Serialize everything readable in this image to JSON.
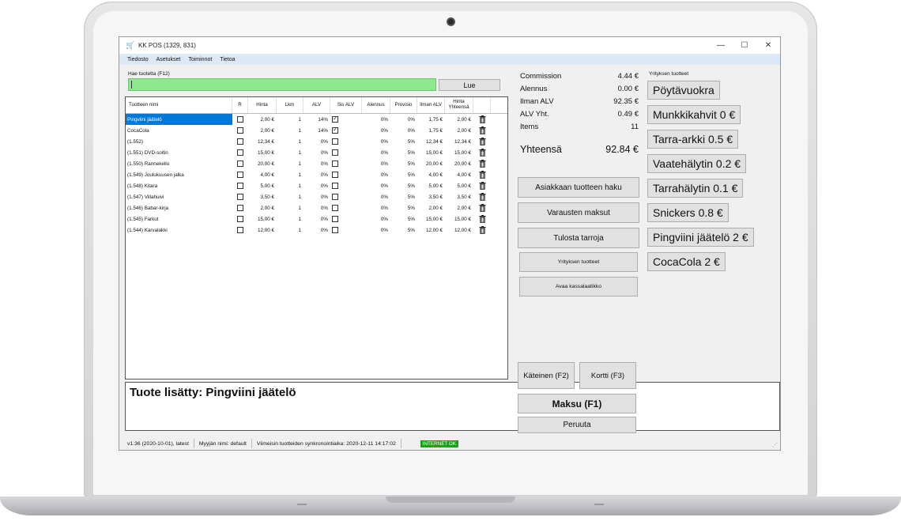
{
  "window": {
    "title": "KK POS (1329, 831)",
    "app_icon": "🛒",
    "minimize": "—",
    "maximize": "☐",
    "close": "✕"
  },
  "menu": [
    "Tiedosto",
    "Asetukset",
    "Toiminnot",
    "Tietoa"
  ],
  "search": {
    "label": "Hae tuotetta (F12)",
    "value": "",
    "button": "Lue"
  },
  "table": {
    "headers": {
      "name": "Tuotteen nimi",
      "r": "R",
      "hinta": "Hinta",
      "lkm": "Lkm",
      "alv": "ALV",
      "sis_alv": "Sis ALV",
      "alennus": "Alennus",
      "provisio": "Provisio",
      "ilman_alv": "Ilman ALV",
      "hinta_yhteensa": "Hinta Yhteensä"
    },
    "rows": [
      {
        "name": "Pingviini jäätelö",
        "r": false,
        "hinta": "2,00 €",
        "lkm": "1",
        "alv": "14%",
        "sis_alv": true,
        "alennus": "0%",
        "provisio": "0%",
        "ilman_alv": "1,75 €",
        "yhteensa": "2,00 €",
        "selected": true
      },
      {
        "name": "CocaCola",
        "r": false,
        "hinta": "2,00 €",
        "lkm": "1",
        "alv": "14%",
        "sis_alv": true,
        "alennus": "0%",
        "provisio": "0%",
        "ilman_alv": "1,75 €",
        "yhteensa": "2,00 €",
        "selected": false
      },
      {
        "name": "(1.552)",
        "r": false,
        "hinta": "12,34 €",
        "lkm": "1",
        "alv": "0%",
        "sis_alv": false,
        "alennus": "0%",
        "provisio": "5%",
        "ilman_alv": "12,34 €",
        "yhteensa": "12,34 €",
        "selected": false
      },
      {
        "name": "(1.551) DVD-soitin",
        "r": false,
        "hinta": "15,00 €",
        "lkm": "1",
        "alv": "0%",
        "sis_alv": false,
        "alennus": "0%",
        "provisio": "5%",
        "ilman_alv": "15,00 €",
        "yhteensa": "15,00 €",
        "selected": false
      },
      {
        "name": "(1.550) Rannekello",
        "r": false,
        "hinta": "20,00 €",
        "lkm": "1",
        "alv": "0%",
        "sis_alv": false,
        "alennus": "0%",
        "provisio": "5%",
        "ilman_alv": "20,00 €",
        "yhteensa": "20,00 €",
        "selected": false
      },
      {
        "name": "(1.549) Joulukuusen jalka",
        "r": false,
        "hinta": "4,00 €",
        "lkm": "1",
        "alv": "0%",
        "sis_alv": false,
        "alennus": "0%",
        "provisio": "5%",
        "ilman_alv": "4,00 €",
        "yhteensa": "4,00 €",
        "selected": false
      },
      {
        "name": "(1.548) Kitara",
        "r": false,
        "hinta": "5,00 €",
        "lkm": "1",
        "alv": "0%",
        "sis_alv": false,
        "alennus": "0%",
        "provisio": "5%",
        "ilman_alv": "5,00 €",
        "yhteensa": "5,00 €",
        "selected": false
      },
      {
        "name": "(1.547) Villahuivi",
        "r": false,
        "hinta": "3,50 €",
        "lkm": "1",
        "alv": "0%",
        "sis_alv": false,
        "alennus": "0%",
        "provisio": "5%",
        "ilman_alv": "3,50 €",
        "yhteensa": "3,50 €",
        "selected": false
      },
      {
        "name": "(1.546) Babar-kirja",
        "r": false,
        "hinta": "2,00 €",
        "lkm": "1",
        "alv": "0%",
        "sis_alv": false,
        "alennus": "0%",
        "provisio": "5%",
        "ilman_alv": "2,00 €",
        "yhteensa": "2,00 €",
        "selected": false
      },
      {
        "name": "(1.545) Farkut",
        "r": false,
        "hinta": "15,00 €",
        "lkm": "1",
        "alv": "0%",
        "sis_alv": false,
        "alennus": "0%",
        "provisio": "5%",
        "ilman_alv": "15,00 €",
        "yhteensa": "15,00 €",
        "selected": false
      },
      {
        "name": "(1.544) Karvalakki",
        "r": false,
        "hinta": "12,00 €",
        "lkm": "1",
        "alv": "0%",
        "sis_alv": false,
        "alennus": "0%",
        "provisio": "5%",
        "ilman_alv": "12,00 €",
        "yhteensa": "12,00 €",
        "selected": false
      }
    ]
  },
  "message": "Tuote lisätty: Pingviini jäätelö",
  "summary": {
    "rows": [
      {
        "label": "Commission",
        "value": "4.44 €"
      },
      {
        "label": "Alennus",
        "value": "0.00 €"
      },
      {
        "label": "Ilman ALV",
        "value": "92.35 €"
      },
      {
        "label": "ALV Yht.",
        "value": "0.49 €"
      },
      {
        "label": "Items",
        "value": "11"
      }
    ],
    "total_label": "Yhteensä",
    "total_value": "92.84 €"
  },
  "actions": {
    "asiakkaan_haku": "Asiakkaan tuotteen haku",
    "varausten_maksut": "Varausten maksut",
    "tulosta_tarroja": "Tulosta tarroja",
    "yrityksen_tuotteet": "Yrityksen tuotteet",
    "avaa_kassalaatikko": "Avaa kassalaatikko",
    "kateinen": "Käteinen (F2)",
    "kortti": "Kortti (F3)",
    "maksu": "Maksu (F1)",
    "peruuta": "Peruuta"
  },
  "company_products": {
    "label": "Yrityksen tuotteet",
    "items": [
      "Pöytävuokra",
      "Munkkikahvit 0 €",
      "Tarra-arkki 0.5 €",
      "Vaatehälytin 0.2 €",
      "Tarrahälytin 0.1 €",
      "Snickers 0.8 €",
      "Pingviini jäätelö 2 €",
      "CocaCola 2 €"
    ]
  },
  "status": {
    "version": "v1.36 (2020-10-01), latest",
    "seller": "Myyjän nimi: default",
    "sync": "Viimeisin tuotteiden synkronointiaika: 2020-12-11 14:17:02",
    "internet": "INTERNET OK"
  }
}
